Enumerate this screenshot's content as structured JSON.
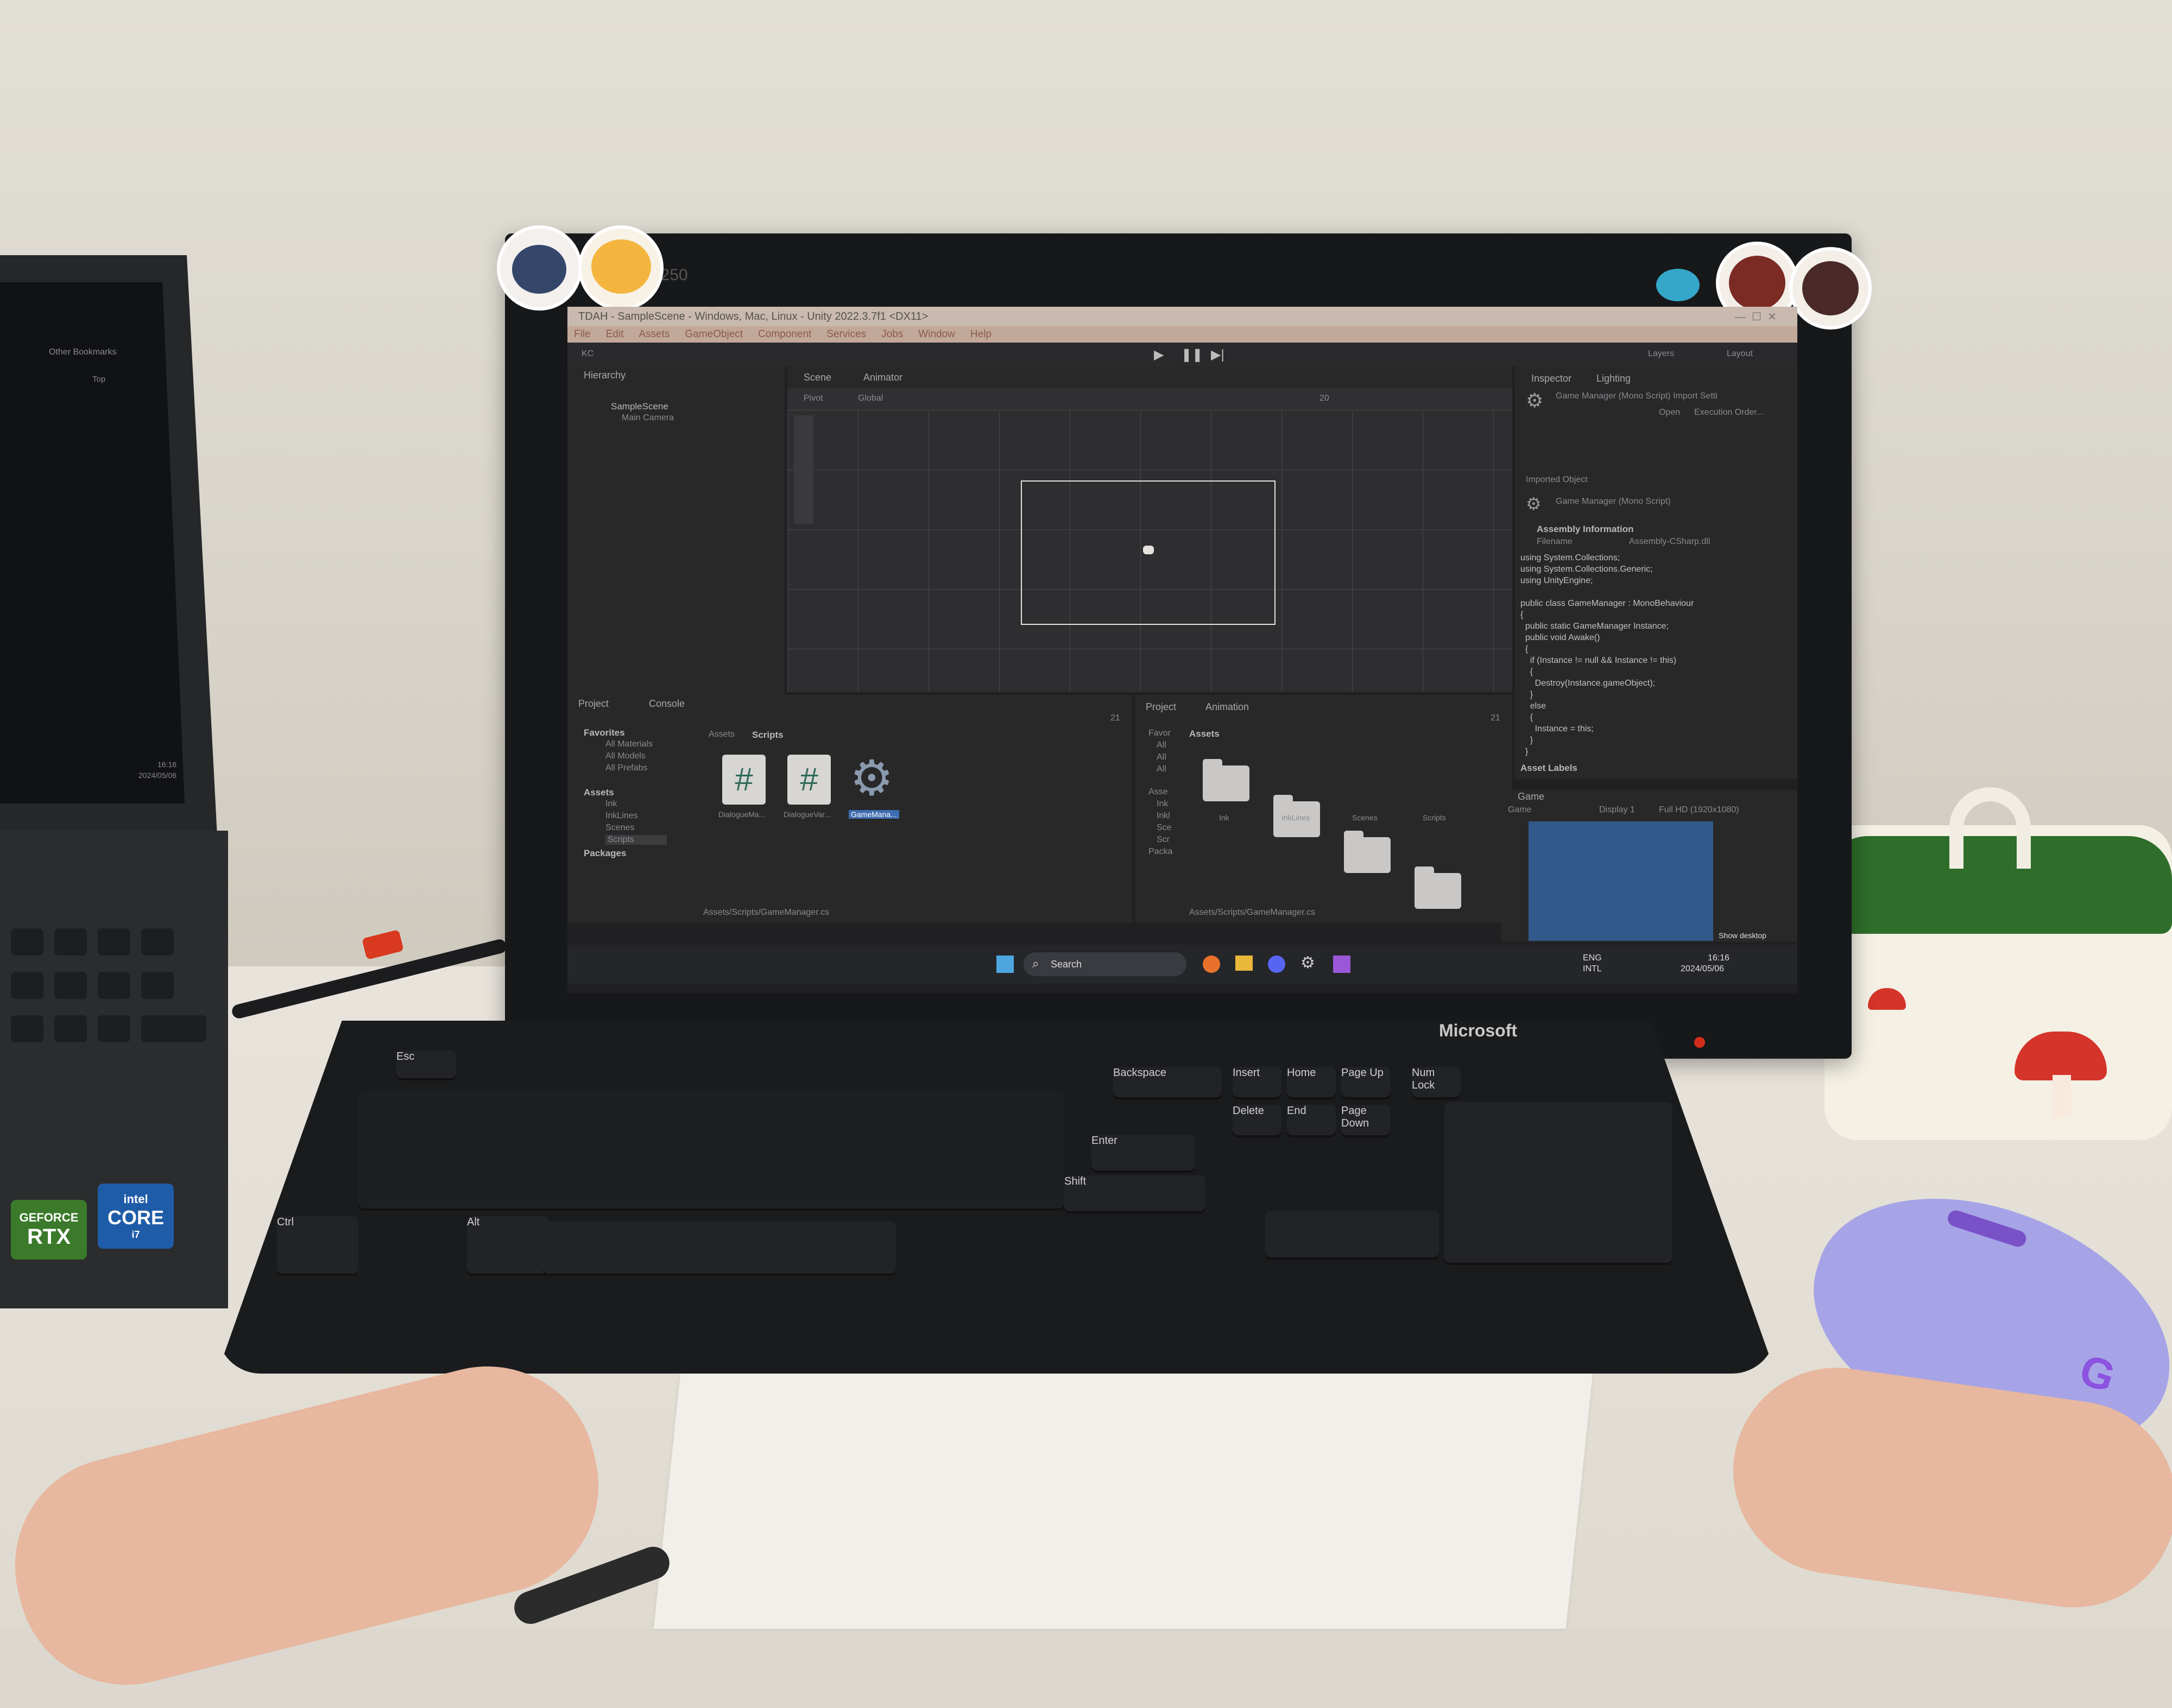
{
  "monitor": {
    "model_label": "2250",
    "unity": {
      "window_title": "TDAH - SampleScene - Windows, Mac, Linux - Unity 2022.3.7f1 <DX11>",
      "menu": [
        "File",
        "Edit",
        "Assets",
        "GameObject",
        "Component",
        "Services",
        "Jobs",
        "Window",
        "Help"
      ],
      "toolbar": {
        "account": "KC",
        "layers": "Layers",
        "layout": "Layout"
      },
      "hierarchy": {
        "tab": "Hierarchy",
        "scene": "SampleScene",
        "camera": "Main Camera"
      },
      "scene_tabs": [
        "Scene",
        "Animator"
      ],
      "scene_toolbar": {
        "pivot": "Pivot",
        "global": "Global",
        "grid_size": "20"
      },
      "inspector": {
        "tabs": [
          "Inspector",
          "Lighting"
        ],
        "header": "Game Manager (Mono Script) Import Setti",
        "open": "Open",
        "execution_order": "Execution Order...",
        "imported_object": "Imported Object",
        "object_name": "Game Manager (Mono Script)",
        "assembly_info": "Assembly Information",
        "filename_label": "Filename",
        "filename_value": "Assembly-CSharp.dll",
        "code": "using System.Collections;\nusing System.Collections.Generic;\nusing UnityEngine;\n\npublic class GameManager : MonoBehaviour\n{\n  public static GameManager Instance;\n  public void Awake()\n  {\n    if (Instance != null && Instance != this)\n    {\n      Destroy(Instance.gameObject);\n    }\n    else\n    {\n      Instance = this;\n    }\n  }",
        "asset_labels": "Asset Labels"
      },
      "project_left": {
        "tabs": [
          "Project",
          "Console"
        ],
        "favorites": "Favorites",
        "fav_items": [
          "All Materials",
          "All Models",
          "All Prefabs"
        ],
        "assets": "Assets",
        "asset_items": [
          "Ink",
          "InkLines",
          "Scenes",
          "Scripts"
        ],
        "packages": "Packages",
        "breadcrumb_root": "Assets",
        "breadcrumb_leaf": "Scripts",
        "files": [
          "DialogueMa...",
          "DialogueVar...",
          "GameMana..."
        ],
        "status_path": "Assets/Scripts/GameManager.cs",
        "count": "21"
      },
      "project_right": {
        "tabs": [
          "Project",
          "Animation"
        ],
        "tree": [
          "Favor",
          "All",
          "All",
          "All",
          "Asse",
          "Ink",
          "Inkl",
          "Sce",
          "Scr",
          "Packa"
        ],
        "header": "Assets",
        "folders": [
          "Ink",
          "InkLines",
          "Scenes",
          "Scripts"
        ],
        "status_path": "Assets/Scripts/GameManager.cs",
        "count": "21"
      },
      "game": {
        "tab": "Game",
        "mode": "Game",
        "display": "Display 1",
        "resolution": "Full HD (1920x1080)",
        "show_desktop": "Show desktop"
      }
    },
    "taskbar": {
      "search": "Search",
      "lang_top": "ENG",
      "lang_bottom": "INTL",
      "time": "16:16",
      "date": "2024/05/06"
    }
  },
  "laptop": {
    "bookmarks": "Other Bookmarks",
    "top": "Top",
    "time": "16:16",
    "date": "2024/05/06",
    "sticker_nvidia_top": "GEFORCE",
    "sticker_nvidia_bottom": "RTX",
    "sticker_intel_top": "intel",
    "sticker_intel_mid": "CORE",
    "sticker_intel_bottom": "i7"
  },
  "keyboard": {
    "brand": "Microsoft",
    "keys_row_labels": [
      "Esc",
      "Backspace",
      "Enter",
      "Shift",
      "Ctrl",
      "Alt",
      "Insert",
      "Home",
      "Page Up",
      "Delete",
      "End",
      "Page Down",
      "Num Lock"
    ]
  }
}
